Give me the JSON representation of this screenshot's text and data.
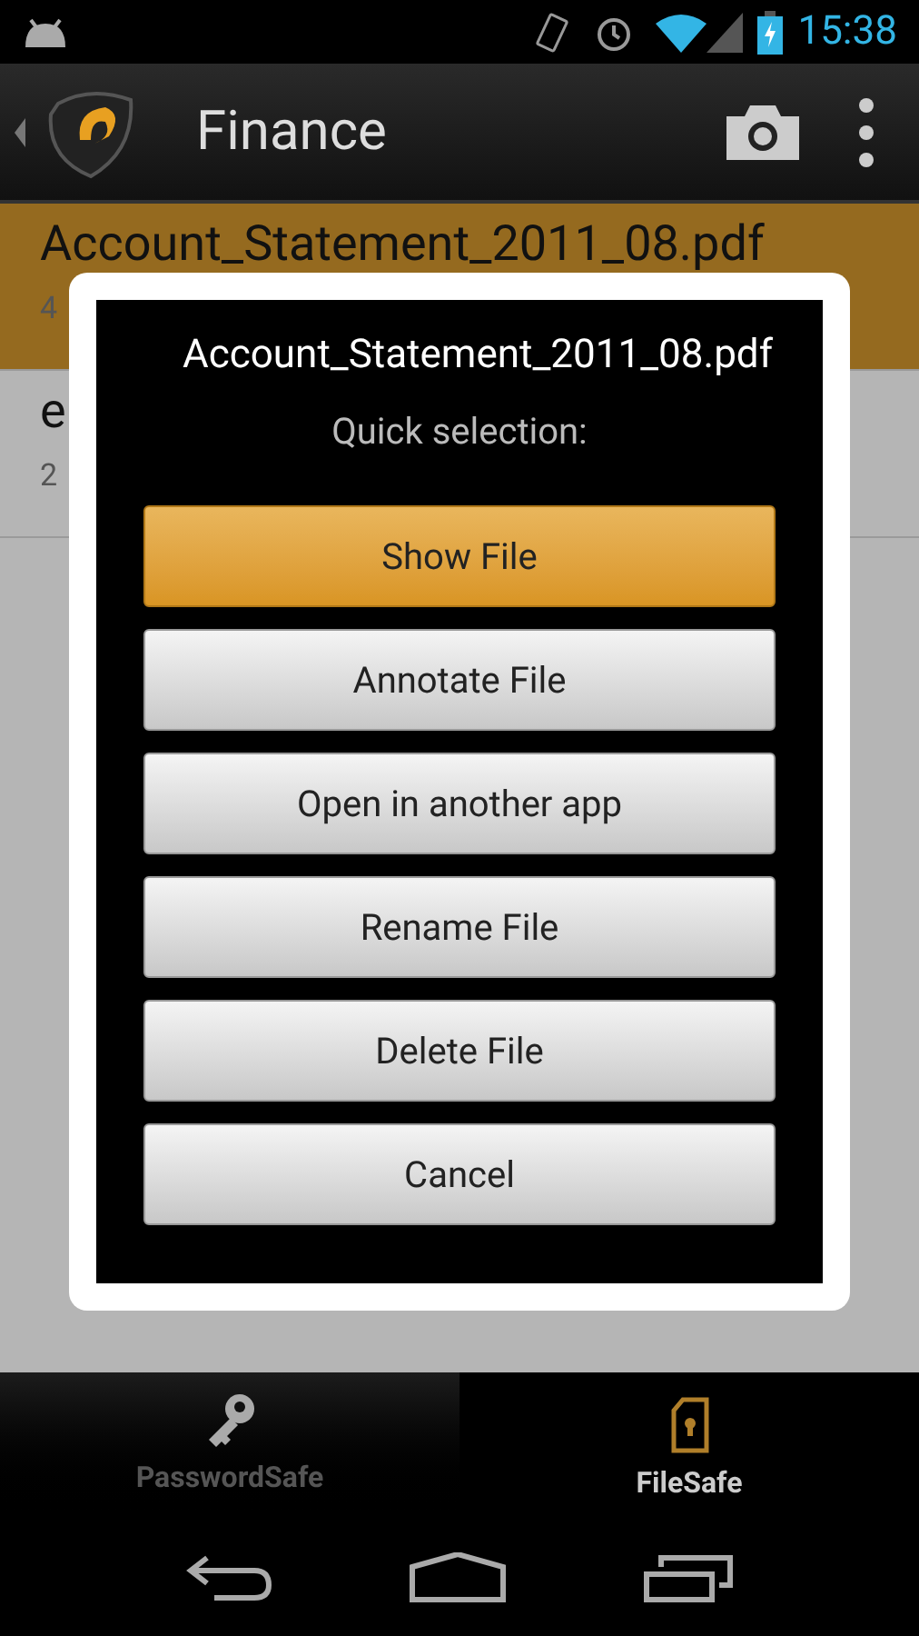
{
  "status_bar": {
    "time": "15:38"
  },
  "action_bar": {
    "title": "Finance"
  },
  "list": [
    {
      "title": "Account_Statement_2011_08.pdf",
      "subtitle": "4",
      "selected": true
    },
    {
      "title": "e",
      "subtitle": "2",
      "selected": false
    }
  ],
  "dialog": {
    "title": "Account_Statement_2011_08.pdf",
    "message": "Quick selection:",
    "buttons": [
      {
        "label": "Show File",
        "selected": true
      },
      {
        "label": "Annotate File",
        "selected": false
      },
      {
        "label": "Open in another app",
        "selected": false
      },
      {
        "label": "Rename File",
        "selected": false
      },
      {
        "label": "Delete File",
        "selected": false
      },
      {
        "label": "Cancel",
        "selected": false
      }
    ]
  },
  "tabs": [
    {
      "label": "PasswordSafe",
      "kind": "key",
      "selected": false
    },
    {
      "label": "FileSafe",
      "kind": "file",
      "selected": true
    }
  ]
}
